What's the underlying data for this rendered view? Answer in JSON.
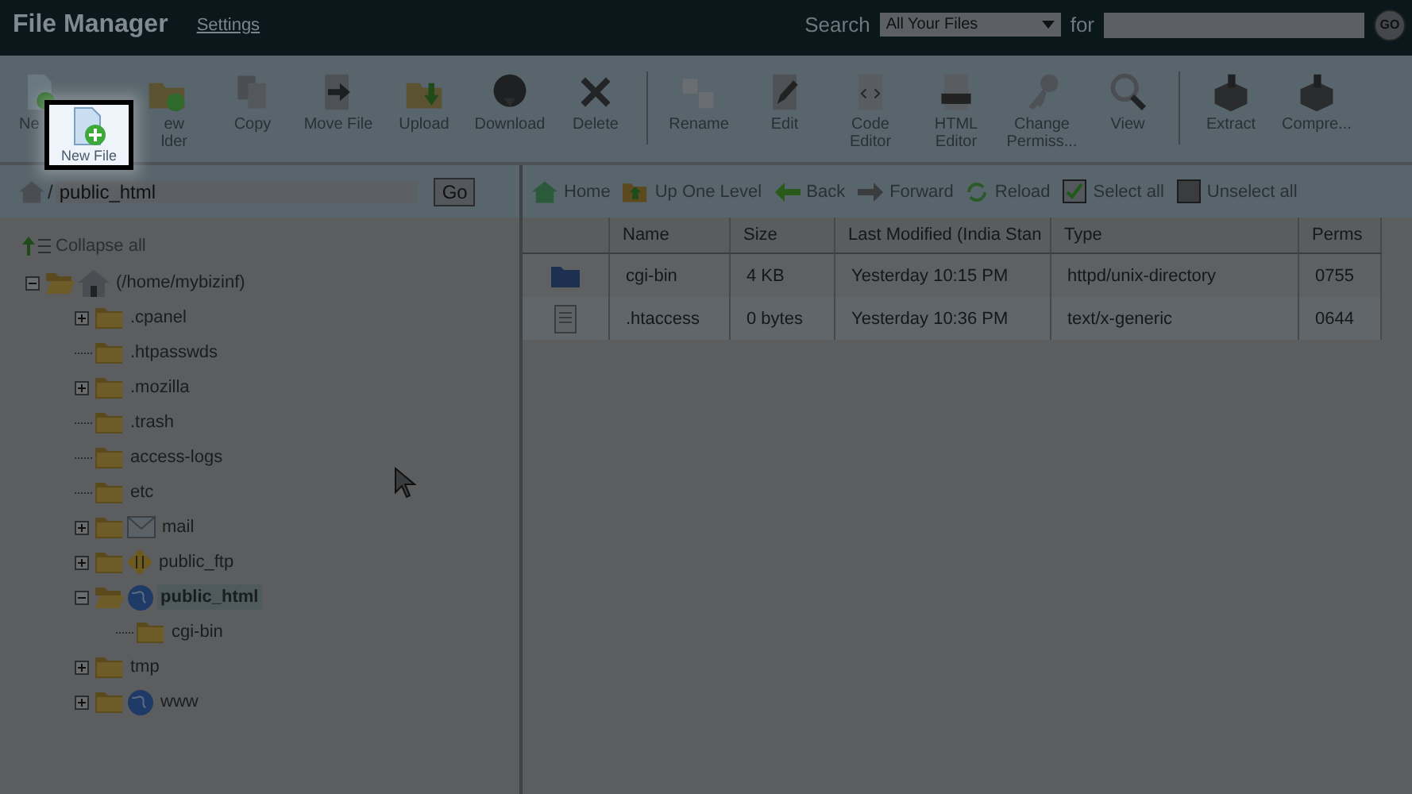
{
  "header": {
    "title": "File Manager",
    "settings_link": "Settings",
    "search_label": "Search",
    "search_scope": "All Your Files",
    "for_label": "for",
    "go_button": "GO"
  },
  "toolbar": [
    [
      {
        "lines": [
          "Ne"
        ]
      },
      {
        "lines": [
          "ew",
          "lder"
        ]
      },
      {
        "lines": [
          "Copy"
        ]
      },
      {
        "lines": [
          "Move File"
        ]
      },
      {
        "lines": [
          "Upload"
        ]
      },
      {
        "lines": [
          "Download"
        ]
      },
      {
        "lines": [
          "Delete"
        ]
      }
    ],
    [
      {
        "lines": [
          "Rename"
        ]
      },
      {
        "lines": [
          "Edit"
        ]
      },
      {
        "lines": [
          "Code",
          "Editor"
        ]
      },
      {
        "lines": [
          "HTML",
          "Editor"
        ]
      },
      {
        "lines": [
          "Change",
          "Permiss..."
        ]
      },
      {
        "lines": [
          "View"
        ]
      }
    ],
    [
      {
        "lines": [
          "Extract"
        ]
      },
      {
        "lines": [
          "Compre..."
        ]
      }
    ]
  ],
  "highlight": {
    "label": "New File"
  },
  "path_bar": {
    "prefix": "/",
    "value": "public_html",
    "go_button": "Go"
  },
  "collapse_all": "Collapse all",
  "tree": {
    "label": "(/home/mybizinf)",
    "kind": "home",
    "expanded": true,
    "selected": false,
    "children": [
      {
        "label": ".cpanel",
        "expandable": true,
        "expanded": false,
        "selected": false
      },
      {
        "label": ".htpasswds",
        "selected": false
      },
      {
        "label": ".mozilla",
        "expandable": true,
        "expanded": false,
        "selected": false
      },
      {
        "label": ".trash",
        "selected": false
      },
      {
        "label": "access-logs",
        "selected": false
      },
      {
        "label": "etc",
        "selected": false
      },
      {
        "label": "mail",
        "kind": "mail",
        "expandable": true,
        "expanded": false,
        "selected": false
      },
      {
        "label": "public_ftp",
        "kind": "ftp",
        "expandable": true,
        "expanded": false,
        "selected": false
      },
      {
        "label": "public_html",
        "kind": "globe",
        "expandable": true,
        "expanded": true,
        "selected": true,
        "children": [
          {
            "label": "cgi-bin",
            "selected": false
          }
        ]
      },
      {
        "label": "tmp",
        "expandable": true,
        "expanded": false,
        "selected": false
      },
      {
        "label": "www",
        "kind": "globe",
        "expandable": true,
        "expanded": false,
        "selected": false
      }
    ]
  },
  "nav": [
    {
      "label": "Home"
    },
    {
      "label": "Up One Level"
    },
    {
      "label": "Back"
    },
    {
      "label": "Forward"
    },
    {
      "label": "Reload"
    },
    {
      "label": "Select all",
      "checked": true
    },
    {
      "label": "Unselect all",
      "checked": false
    }
  ],
  "table": {
    "columns": [
      "Name",
      "Size",
      "Last Modified (India Stan",
      "Type",
      "Perms"
    ],
    "rows": [
      {
        "kind": "folder",
        "cells": [
          "cgi-bin",
          "4 KB",
          "Yesterday 10:15 PM",
          "httpd/unix-directory",
          "0755"
        ]
      },
      {
        "kind": "file",
        "cells": [
          ".htaccess",
          "0 bytes",
          "Yesterday 10:36 PM",
          "text/x-generic",
          "0644"
        ]
      }
    ]
  }
}
